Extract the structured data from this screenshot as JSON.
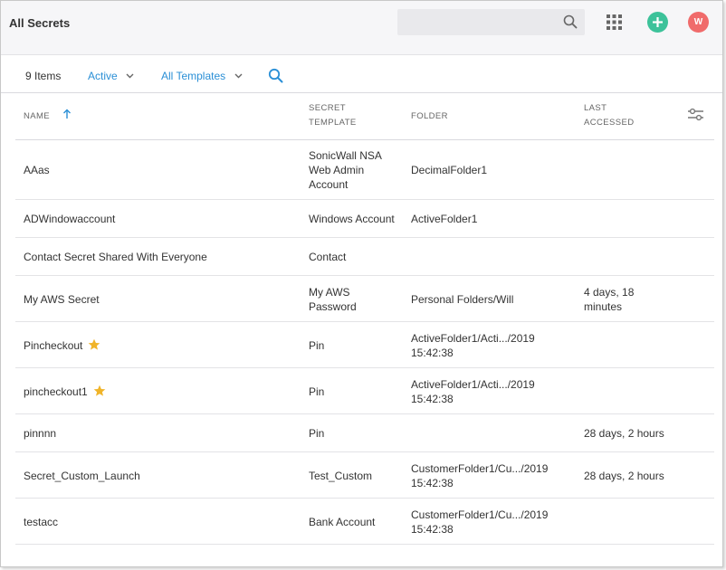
{
  "header": {
    "title": "All Secrets",
    "search_placeholder": "",
    "avatar_initial": "W"
  },
  "toolbar": {
    "item_count": "9 Items",
    "status_filter": "Active",
    "template_filter": "All Templates"
  },
  "table": {
    "columns": {
      "name": "NAME",
      "template_line1": "SECRET",
      "template_line2": "TEMPLATE",
      "folder": "FOLDER",
      "last_line1": "LAST",
      "last_line2": "ACCESSED"
    },
    "rows": [
      {
        "name": "AAas",
        "favorite": false,
        "template": [
          "SonicWall NSA",
          "Web Admin",
          "Account"
        ],
        "folder": [
          "DecimalFolder1"
        ],
        "last": []
      },
      {
        "name": "ADWindowaccount",
        "favorite": false,
        "template": [
          "Windows Account"
        ],
        "folder": [
          "ActiveFolder1"
        ],
        "last": []
      },
      {
        "name": "Contact Secret Shared With Everyone",
        "favorite": false,
        "template": [
          "Contact"
        ],
        "folder": [],
        "last": []
      },
      {
        "name": "My AWS Secret",
        "favorite": false,
        "template": [
          "My AWS",
          "Password"
        ],
        "folder": [
          "Personal Folders/Will"
        ],
        "last": [
          "4 days, 18",
          "minutes"
        ]
      },
      {
        "name": "Pincheckout",
        "favorite": true,
        "template": [
          "Pin"
        ],
        "folder": [
          "ActiveFolder1/Acti.../2019",
          "15:42:38"
        ],
        "last": []
      },
      {
        "name": "pincheckout1",
        "favorite": true,
        "template": [
          "Pin"
        ],
        "folder": [
          "ActiveFolder1/Acti.../2019",
          "15:42:38"
        ],
        "last": []
      },
      {
        "name": "pinnnn",
        "favorite": false,
        "template": [
          "Pin"
        ],
        "folder": [],
        "last": [
          "28 days, 2 hours"
        ]
      },
      {
        "name": "Secret_Custom_Launch",
        "favorite": false,
        "template": [
          "Test_Custom"
        ],
        "folder": [
          "CustomerFolder1/Cu.../2019",
          "15:42:38"
        ],
        "last": [
          "28 days, 2 hours"
        ]
      },
      {
        "name": "testacc",
        "favorite": false,
        "template": [
          "Bank Account"
        ],
        "folder": [
          "CustomerFolder1/Cu.../2019",
          "15:42:38"
        ],
        "last": []
      }
    ]
  },
  "colors": {
    "accent": "#2a8fd6",
    "add_button": "#3dc29a",
    "avatar": "#f06b6b",
    "star": "#f0b429"
  },
  "icons": [
    "search-icon",
    "apps-grid-icon",
    "plus-icon",
    "chevron-down-icon",
    "sort-ascending-icon",
    "column-settings-icon",
    "star-icon"
  ]
}
